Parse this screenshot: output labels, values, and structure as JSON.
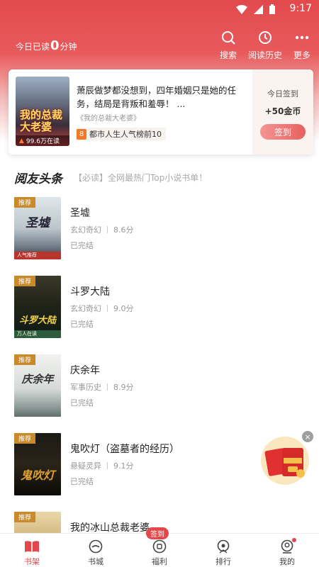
{
  "status_bar": {
    "time": "9:17"
  },
  "header": {
    "read_prefix": "今日已读",
    "read_minutes": "0",
    "read_suffix": "分钟",
    "actions": [
      {
        "label": "搜索",
        "icon": "search-icon"
      },
      {
        "label": "阅读历史",
        "icon": "clock-icon"
      },
      {
        "label": "更多",
        "icon": "more-icon"
      }
    ]
  },
  "feature": {
    "cover_title": "我的总裁大老婆",
    "heat": "99.6万在读",
    "description": "萧辰做梦都没想到，四年婚姻只是她的任务，结局是背叛和羞辱！ ...",
    "source": "《我的总裁大老婆》",
    "rank_badge": "8",
    "rank_text": "都市人生人气榜前10",
    "signin_label": "今日签到",
    "signin_reward": "+50金币",
    "signin_button": "签到"
  },
  "headline": {
    "title": "阅友头条",
    "tagline": "【必读】全网最热门Top小说书单！"
  },
  "books": [
    {
      "tag": "推荐",
      "cover_text": "圣墟",
      "cover_band": "人气推荐",
      "name": "圣墟",
      "genre": "玄幻奇幻",
      "score": "8.6分",
      "status": "已完结"
    },
    {
      "tag": "推荐",
      "cover_text": "斗罗大陆",
      "cover_band": "万人在读",
      "name": "斗罗大陆",
      "genre": "玄幻奇幻",
      "score": "9.0分",
      "status": "已完结"
    },
    {
      "tag": "推荐",
      "cover_text": "庆余年",
      "cover_band": "",
      "name": "庆余年",
      "genre": "军事历史",
      "score": "8.9分",
      "status": "已完结"
    },
    {
      "tag": "推荐",
      "cover_text": "鬼吹灯",
      "cover_band": "",
      "name": "鬼吹灯（盗墓者的经历）",
      "genre": "悬疑灵异",
      "score": "9.1分",
      "status": "已完结"
    },
    {
      "tag": "推荐",
      "cover_text": "",
      "cover_band": "",
      "name": "我的冰山总裁老婆",
      "genre": "",
      "score": "",
      "status": ""
    }
  ],
  "float_banner": {
    "close": "×"
  },
  "tabs": [
    {
      "label": "书架",
      "icon": "bookshelf-icon",
      "active": true
    },
    {
      "label": "书城",
      "icon": "bookstore-icon"
    },
    {
      "label": "福利",
      "icon": "welfare-icon",
      "badge": "签到"
    },
    {
      "label": "排行",
      "icon": "rank-icon"
    },
    {
      "label": "我的",
      "icon": "profile-icon"
    }
  ],
  "colors": {
    "accent": "#e2484b",
    "tag": "#c98a2b"
  }
}
